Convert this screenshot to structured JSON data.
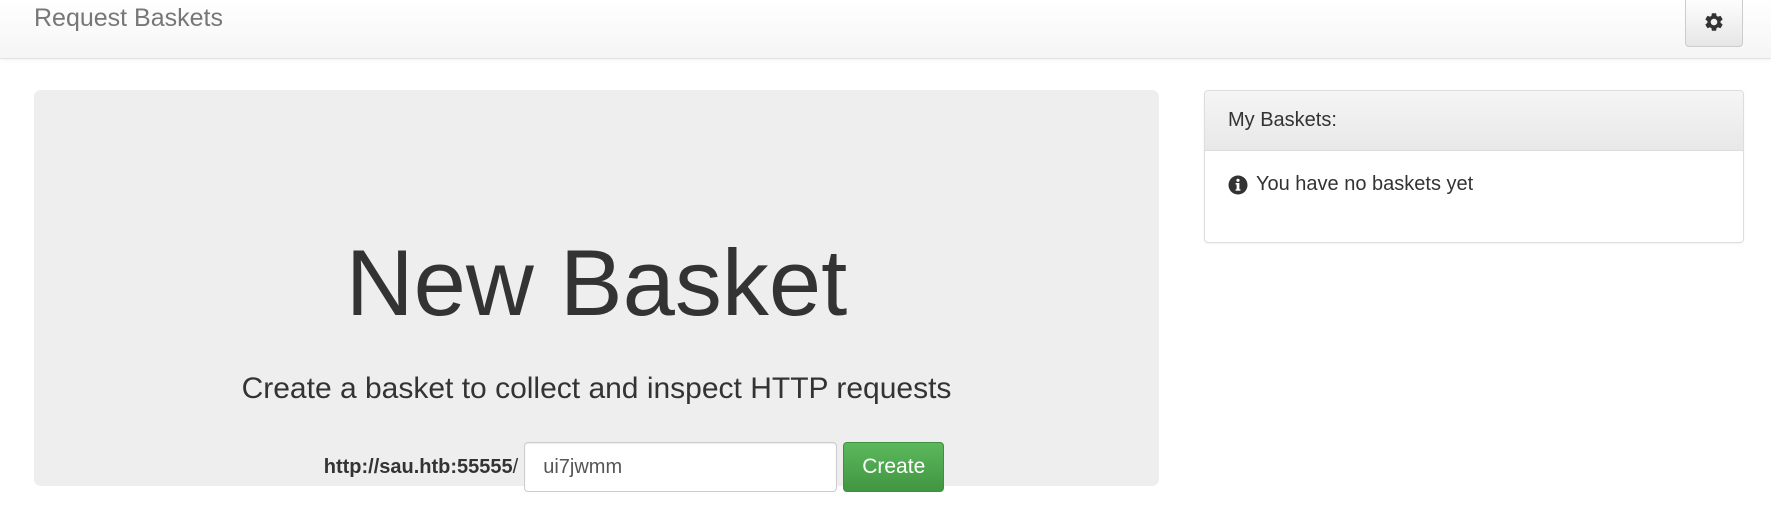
{
  "navbar": {
    "brand": "Request Baskets",
    "settings_icon": "gear-icon"
  },
  "jumbotron": {
    "title": "New Basket",
    "subtitle": "Create a basket to collect and inspect HTTP requests",
    "url_prefix": "http://sau.htb:55555",
    "url_slash": "/",
    "basket_name_value": "ui7jwmm",
    "create_label": "Create"
  },
  "my_baskets": {
    "heading": "My Baskets:",
    "empty_icon": "info-circle-icon",
    "empty_message": "You have no baskets yet"
  },
  "colors": {
    "create_button": "#5cb85c",
    "jumbotron_bg": "#eeeeee",
    "brand_text": "#777777"
  }
}
